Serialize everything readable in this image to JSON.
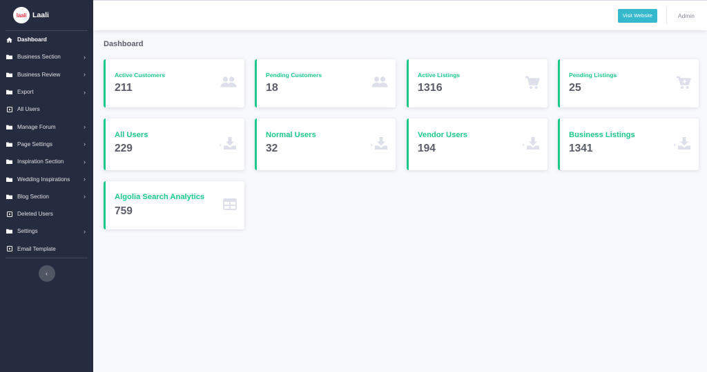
{
  "brand": {
    "logo_text": "laali",
    "name": "Laali"
  },
  "sidebar": {
    "items": [
      {
        "label": "Dashboard",
        "icon": "home-icon",
        "active": true,
        "has_submenu": false
      },
      {
        "label": "Business Section",
        "icon": "folder-icon",
        "has_submenu": true
      },
      {
        "label": "Business Review",
        "icon": "folder-icon",
        "has_submenu": true
      },
      {
        "label": "Export",
        "icon": "folder-icon",
        "has_submenu": true
      },
      {
        "label": "All Users",
        "icon": "square-caret-icon",
        "has_submenu": false
      },
      {
        "label": "Manage Forum",
        "icon": "folder-icon",
        "has_submenu": true
      },
      {
        "label": "Page Settings",
        "icon": "folder-icon",
        "has_submenu": true
      },
      {
        "label": "Inspiration Section",
        "icon": "folder-icon",
        "has_submenu": true
      },
      {
        "label": "Wedding Inspirations",
        "icon": "folder-icon",
        "has_submenu": true
      },
      {
        "label": "Blog Section",
        "icon": "folder-icon",
        "has_submenu": true
      },
      {
        "label": "Deleted Users",
        "icon": "square-caret-icon",
        "has_submenu": false
      },
      {
        "label": "Settings",
        "icon": "folder-icon",
        "has_submenu": true
      },
      {
        "label": "Email Template",
        "icon": "square-caret-icon",
        "has_submenu": false
      }
    ],
    "caret": "›",
    "toggle": "‹"
  },
  "topbar": {
    "visit_label": "Visit Website",
    "user_name": "Admin"
  },
  "page": {
    "title": "Dashboard"
  },
  "cards": [
    {
      "label": "Active Customers",
      "value": "211",
      "icon": "users-icon"
    },
    {
      "label": "Pending Customers",
      "value": "18",
      "icon": "users-icon"
    },
    {
      "label": "Active Listings",
      "value": "1316",
      "icon": "cart-icon"
    },
    {
      "label": "Pending Listings",
      "value": "25",
      "icon": "cart-plus-icon"
    },
    {
      "label": "All Users",
      "value": "229",
      "icon": "download-icon"
    },
    {
      "label": "Normal Users",
      "value": "32",
      "icon": "download-icon"
    },
    {
      "label": "Vendor Users",
      "value": "194",
      "icon": "download-icon"
    },
    {
      "label": "Business Listings",
      "value": "1341",
      "icon": "download-icon"
    },
    {
      "label": "Algolia Search Analytics",
      "value": "759",
      "icon": "table-icon"
    }
  ],
  "colors": {
    "sidebar_bg": "#262c3f",
    "accent_green": "#1cc88a",
    "visit_button": "#36b9cc",
    "icon_gray": "#dddfeb"
  }
}
